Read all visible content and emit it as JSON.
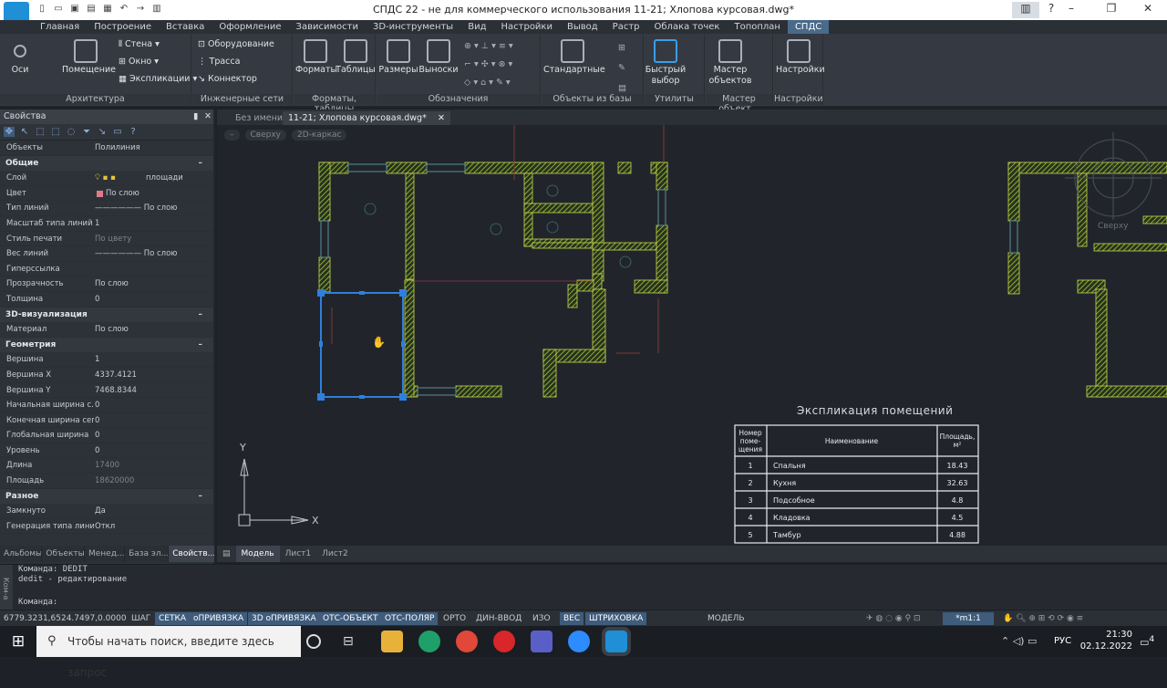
{
  "window": {
    "title": "СПДС 22 - не для коммерческого использования 11-21; Хлопова курсовая.dwg*"
  },
  "menu_tabs": [
    "Главная",
    "Построение",
    "Вставка",
    "Оформление",
    "Зависимости",
    "3D-инструменты",
    "Вид",
    "Настройки",
    "Вывод",
    "Растр",
    "Облака точек",
    "Топоплан",
    "СПДС"
  ],
  "ribbon": {
    "architecture": {
      "title": "Архитектура",
      "osi": "Оси",
      "room": "Помещение",
      "wall": "Стена",
      "window": "Окно",
      "explication": "Экспликации"
    },
    "engineering": {
      "title": "Инженерные сети",
      "equipment": "Оборудование",
      "route": "Трасса",
      "connector": "Коннектор"
    },
    "tables": {
      "title": "Форматы, таблицы",
      "formats": "Форматы",
      "tables": "Таблицы"
    },
    "designations": {
      "title": "Обозначения",
      "sizes": "Размеры",
      "callouts": "Выноски"
    },
    "objects": {
      "title": "Объекты из базы",
      "standard": "Стандартные"
    },
    "utilities": {
      "title": "Утилиты",
      "quick_select": "Быстрый выбор"
    },
    "master": {
      "title": "Мастер объект...",
      "label": "Мастер объектов"
    },
    "settings": {
      "title": "Настройки",
      "label": "Настройки"
    }
  },
  "doc_tabs": {
    "tab1": "Без имени0",
    "tab2": "11-21; Хлопова курсовая.dwg*"
  },
  "view_labels": [
    "–",
    "Сверху",
    "2D-каркас"
  ],
  "properties": {
    "header": "Свойства",
    "object_label": "Объекты",
    "object_value": "Полилиния",
    "sections": {
      "general": "Общие",
      "vis3d": "3D-визуализация",
      "geometry": "Геометрия",
      "misc": "Разное"
    },
    "general": [
      {
        "k": "Слой",
        "v": "площади"
      },
      {
        "k": "Цвет",
        "v": "По слою"
      },
      {
        "k": "Тип линий",
        "v": "——————  По слою"
      },
      {
        "k": "Масштаб типа линий",
        "v": "1"
      },
      {
        "k": "Стиль печати",
        "v": "По цвету"
      },
      {
        "k": "Вес линий",
        "v": "——————  По слою"
      },
      {
        "k": "Гиперссылка",
        "v": ""
      },
      {
        "k": "Прозрачность",
        "v": "По слою"
      },
      {
        "k": "Толщина",
        "v": "0"
      }
    ],
    "vis3d": [
      {
        "k": "Материал",
        "v": "По слою"
      }
    ],
    "geometry": [
      {
        "k": "Вершина",
        "v": "1"
      },
      {
        "k": "Вершина X",
        "v": "4337.4121"
      },
      {
        "k": "Вершина Y",
        "v": "7468.8344"
      },
      {
        "k": "Начальная ширина с...",
        "v": "0"
      },
      {
        "k": "Конечная ширина сег...",
        "v": "0"
      },
      {
        "k": "Глобальная ширина",
        "v": "0"
      },
      {
        "k": "Уровень",
        "v": "0"
      },
      {
        "k": "Длина",
        "v": "17400"
      },
      {
        "k": "Площадь",
        "v": "18620000"
      }
    ],
    "misc": [
      {
        "k": "Замкнуто",
        "v": "Да"
      },
      {
        "k": "Генерация типа линий",
        "v": "Откл"
      }
    ]
  },
  "palette_tabs": [
    "Альбомы",
    "Объекты",
    "Менед...",
    "База эл...",
    "Свойств..."
  ],
  "layout_tabs": [
    "Модель",
    "Лист1",
    "Лист2"
  ],
  "drawing": {
    "table_title": "Экспликация помещений",
    "col_no": [
      "Номер",
      "поме-",
      "щения"
    ],
    "col_name": "Наименование",
    "col_area": "Площадь,",
    "col_area_unit": "м²",
    "rows": [
      {
        "n": "1",
        "name": "Спальня",
        "area": "18.43"
      },
      {
        "n": "2",
        "name": "Кухня",
        "area": "32.63"
      },
      {
        "n": "3",
        "name": "Подсобное",
        "area": "4.8"
      },
      {
        "n": "4",
        "name": "Кладовка",
        "area": "4.5"
      },
      {
        "n": "5",
        "name": "Тамбур",
        "area": "4.88"
      }
    ],
    "ucs_x": "X",
    "ucs_y": "Y",
    "compass_label": "Сверху"
  },
  "command": {
    "line1": "Команда: DEDIT",
    "line2": "dedit - редактирование",
    "prompt": "Команда:",
    "side": "Ком-а"
  },
  "status": {
    "coords": "6779.3231,6524.7497,0.0000",
    "items": [
      "ШАГ",
      "СЕТКА",
      "оПРИВЯЗКА",
      "3D оПРИВЯЗКА",
      "ОТС-ОБЪЕКТ",
      "ОТС-ПОЛЯР",
      "ОРТО",
      "ДИН-ВВОД",
      "ИЗО",
      "ВЕС",
      "ШТРИХОВКА"
    ],
    "model": "МОДЕЛЬ",
    "scale": "*m1:1"
  },
  "taskbar": {
    "search_placeholder": "Чтобы начать поиск, введите здесь запрос",
    "lang": "РУС",
    "time": "21:30",
    "date": "02.12.2022",
    "notif": "4"
  }
}
